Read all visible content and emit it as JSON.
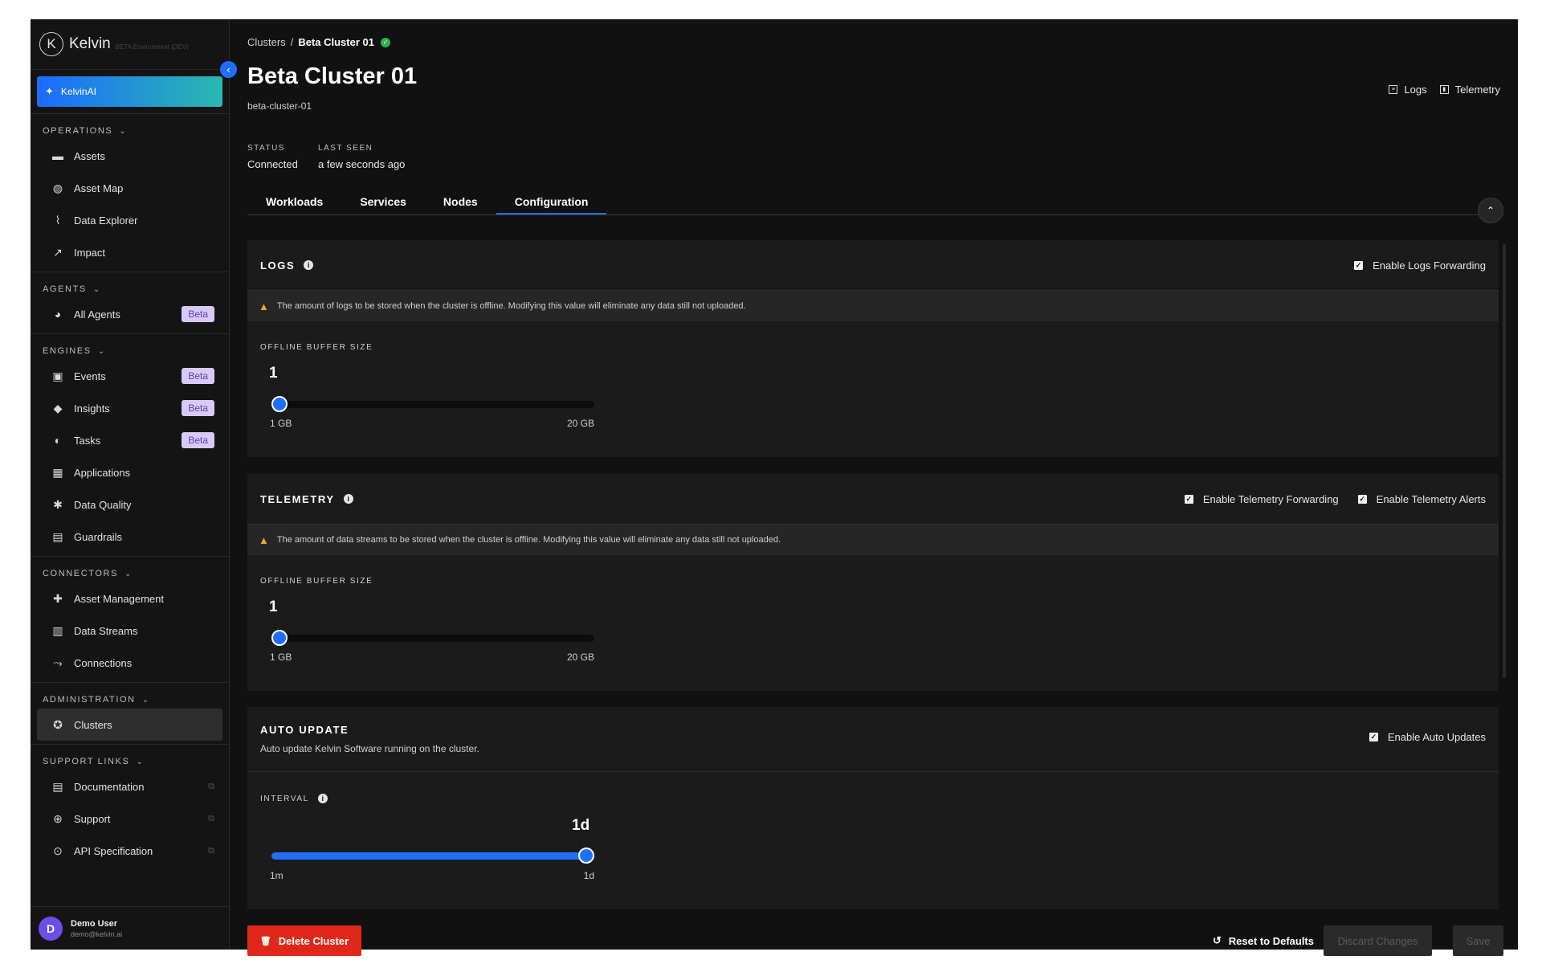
{
  "sidebar": {
    "logo_letter": "K",
    "logo_name": "Kelvin",
    "environment": "BETA Environment (DEV)",
    "ai_button": "KelvinAI",
    "sections": [
      {
        "title": "OPERATIONS",
        "items": [
          {
            "label": "Assets",
            "icon": "briefcase-icon"
          },
          {
            "label": "Asset Map",
            "icon": "globe-icon"
          },
          {
            "label": "Data Explorer",
            "icon": "pulse-icon"
          },
          {
            "label": "Impact",
            "icon": "trend-icon"
          }
        ]
      },
      {
        "title": "AGENTS",
        "items": [
          {
            "label": "All Agents",
            "icon": "agent-icon",
            "badge": "Beta"
          }
        ]
      },
      {
        "title": "ENGINES",
        "items": [
          {
            "label": "Events",
            "icon": "events-icon",
            "badge": "Beta"
          },
          {
            "label": "Insights",
            "icon": "tag-icon",
            "badge": "Beta"
          },
          {
            "label": "Tasks",
            "icon": "tasks-icon",
            "badge": "Beta"
          },
          {
            "label": "Applications",
            "icon": "apps-icon"
          },
          {
            "label": "Data Quality",
            "icon": "gear-icon"
          },
          {
            "label": "Guardrails",
            "icon": "barrier-icon"
          }
        ]
      },
      {
        "title": "CONNECTORS",
        "items": [
          {
            "label": "Asset Management",
            "icon": "asset-mgmt-icon"
          },
          {
            "label": "Data Streams",
            "icon": "chart-icon"
          },
          {
            "label": "Connections",
            "icon": "connections-icon"
          }
        ]
      },
      {
        "title": "ADMINISTRATION",
        "items": [
          {
            "label": "Clusters",
            "icon": "clusters-icon",
            "active": true
          }
        ]
      },
      {
        "title": "SUPPORT LINKS",
        "items": [
          {
            "label": "Documentation",
            "icon": "doc-icon",
            "external": true
          },
          {
            "label": "Support",
            "icon": "lifebuoy-icon",
            "external": true
          },
          {
            "label": "API Specification",
            "icon": "api-icon",
            "external": true
          }
        ]
      }
    ],
    "user": {
      "initial": "D",
      "name": "Demo User",
      "email": "demo@kelvin.ai"
    }
  },
  "header": {
    "breadcrumb_root": "Clusters",
    "breadcrumb_sep": "/",
    "breadcrumb_current": "Beta Cluster 01",
    "title": "Beta Cluster 01",
    "subtitle": "beta-cluster-01",
    "links": {
      "logs": "Logs",
      "telemetry": "Telemetry"
    },
    "status_label": "STATUS",
    "status_value": "Connected",
    "last_seen_label": "LAST SEEN",
    "last_seen_value": "a few seconds ago"
  },
  "tabs": [
    {
      "label": "Workloads"
    },
    {
      "label": "Services"
    },
    {
      "label": "Nodes"
    },
    {
      "label": "Configuration",
      "active": true
    }
  ],
  "logs": {
    "title": "LOGS",
    "checkbox": "Enable Logs Forwarding",
    "warning": "The amount of logs to be stored when the cluster is offline. Modifying this value will eliminate any data still not uploaded.",
    "field_label": "OFFLINE BUFFER SIZE",
    "value": "1",
    "min_label": "1 GB",
    "max_label": "20 GB",
    "min": 1,
    "max": 20,
    "current": 1
  },
  "telemetry": {
    "title": "TELEMETRY",
    "checkbox_forwarding": "Enable Telemetry Forwarding",
    "checkbox_alerts": "Enable Telemetry Alerts",
    "warning": "The amount of data streams to be stored when the cluster is offline. Modifying this value will eliminate any data still not uploaded.",
    "field_label": "OFFLINE BUFFER SIZE",
    "value": "1",
    "min_label": "1 GB",
    "max_label": "20 GB",
    "min": 1,
    "max": 20,
    "current": 1
  },
  "auto_update": {
    "title": "AUTO UPDATE",
    "description": "Auto update Kelvin Software running on the cluster.",
    "checkbox": "Enable Auto Updates",
    "field_label": "INTERVAL",
    "value": "1d",
    "min_label": "1m",
    "max_label": "1d",
    "fraction": 1.0
  },
  "footer": {
    "delete": "Delete Cluster",
    "reset": "Reset to Defaults",
    "discard": "Discard Changes",
    "save": "Save"
  },
  "colors": {
    "accent": "#1f6fff",
    "danger": "#e0281a",
    "success": "#2bb24c",
    "warning": "#f5a623"
  }
}
